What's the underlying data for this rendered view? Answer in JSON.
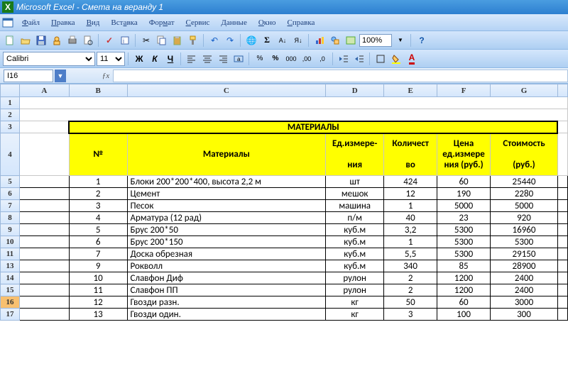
{
  "titlebar": {
    "app": "Microsoft Excel",
    "doc": "Смета на веранду 1"
  },
  "menu": {
    "file": "Файл",
    "edit": "Правка",
    "view": "Вид",
    "insert": "Вставка",
    "format": "Формат",
    "tools": "Сервис",
    "data": "Данные",
    "window": "Окно",
    "help": "Справка"
  },
  "toolbar2": {
    "font": "Calibri",
    "size": "11",
    "zoom": "100%",
    "bold": "Ж",
    "italic": "К",
    "underline": "Ч"
  },
  "namebox": {
    "cell": "I16"
  },
  "columns": [
    "A",
    "B",
    "C",
    "D",
    "E",
    "F",
    "G"
  ],
  "rows_left": [
    "1",
    "2",
    "3",
    "4",
    "5",
    "6",
    "7",
    "8",
    "9",
    "10",
    "11",
    "13",
    "14",
    "15",
    "16",
    "17"
  ],
  "section_title": "МАТЕРИАЛЫ",
  "header": {
    "num": "№",
    "mat": "Материалы",
    "unit_top": "Ед.измере-",
    "unit_bot": "ния",
    "qty_top": "Количест",
    "qty_bot": "во",
    "price_top": "Цена",
    "price_mid": "ед.измере",
    "price_bot": "ния (руб.)",
    "cost_top": "Стоимость",
    "cost_bot": "(руб.)"
  },
  "rows": [
    {
      "n": "1",
      "name": "Блоки 200*200*400, высота 2,2 м",
      "unit": "шт",
      "qty": "424",
      "price": "60",
      "cost": "25440"
    },
    {
      "n": "2",
      "name": "Цемент",
      "unit": "мешок",
      "qty": "12",
      "price": "190",
      "cost": "2280"
    },
    {
      "n": "3",
      "name": "Песок",
      "unit": "машина",
      "qty": "1",
      "price": "5000",
      "cost": "5000"
    },
    {
      "n": "4",
      "name": "Арматура (12 рад)",
      "unit": "п/м",
      "qty": "40",
      "price": "23",
      "cost": "920"
    },
    {
      "n": "5",
      "name": "Брус 200*50",
      "unit": "куб.м",
      "qty": "3,2",
      "price": "5300",
      "cost": "16960"
    },
    {
      "n": "6",
      "name": "Брус 200*150",
      "unit": "куб.м",
      "qty": "1",
      "price": "5300",
      "cost": "5300"
    },
    {
      "n": "7",
      "name": "Доска обрезная",
      "unit": "куб.м",
      "qty": "5,5",
      "price": "5300",
      "cost": "29150"
    },
    {
      "n": "9",
      "name": "Рокволл",
      "unit": "куб.м",
      "qty": "340",
      "price": "85",
      "cost": "28900"
    },
    {
      "n": "10",
      "name": "Славфон Диф",
      "unit": "рулон",
      "qty": "2",
      "price": "1200",
      "cost": "2400"
    },
    {
      "n": "11",
      "name": "Славфон ПП",
      "unit": "рулон",
      "qty": "2",
      "price": "1200",
      "cost": "2400"
    },
    {
      "n": "12",
      "name": "Гвозди разн.",
      "unit": "кг",
      "qty": "50",
      "price": "60",
      "cost": "3000"
    },
    {
      "n": "13",
      "name": "Гвозди один.",
      "unit": "кг",
      "qty": "3",
      "price": "100",
      "cost": "300"
    }
  ]
}
